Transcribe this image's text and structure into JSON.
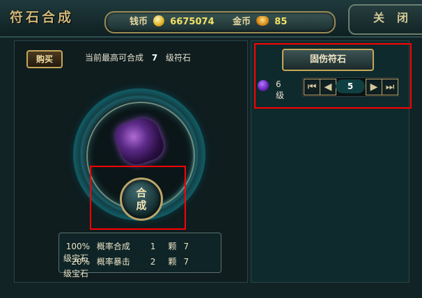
{
  "window": {
    "title": "符石合成",
    "close_label": "关闭"
  },
  "currency": {
    "copper_label": "钱币",
    "copper_value": "6675074",
    "gold_label": "金币",
    "gold_value": "85"
  },
  "left": {
    "buy_label": "购买",
    "max_level_prefix": "当前最高可合成",
    "max_level_value": "7",
    "max_level_suffix": "级符石",
    "compose_label_top": "合",
    "compose_label_bottom": "成",
    "probabilities": [
      {
        "percent": "100%",
        "text": "概率合成",
        "count": "1",
        "unit": "颗",
        "level": "7",
        "gem": "级宝石"
      },
      {
        "percent": "20%",
        "text": "概率暴击",
        "count": "2",
        "unit": "颗",
        "level": "7",
        "gem": "级宝石"
      }
    ]
  },
  "right": {
    "rune_button": "固伤符石",
    "rune_level": "6级",
    "stepper_value": "5"
  },
  "icons": {
    "copper": "coin-icon",
    "gold": "ingot-icon",
    "rune": "rune-icon",
    "gem": "gem-icon"
  }
}
